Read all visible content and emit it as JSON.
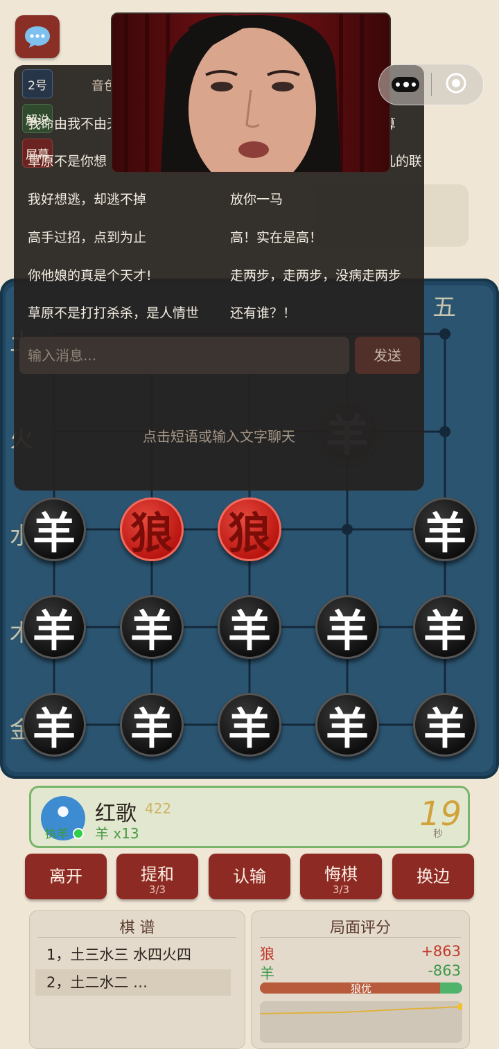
{
  "chat": {
    "side_buttons": [
      "2号",
      "解说",
      "屏幕"
    ],
    "header_partial": "音色",
    "phrases_left": [
      "我命由我不由天",
      "草原不是你想",
      "我好想逃，却逃不掉",
      "高手过招，点到为止",
      "你他娘的真是个天才!",
      "草原不是打打杀杀，是人情世"
    ],
    "phrases_right": [
      "算",
      "儿的联",
      "放你一马",
      "高！实在是高！",
      "走两步，走两步，没病走两步",
      "还有谁？！"
    ],
    "input_placeholder": "输入消息...",
    "send_label": "发送",
    "hint": "点击短语或输入文字聊天"
  },
  "board": {
    "col_label": "五",
    "row_labels": [
      "土",
      "火",
      "水",
      "木",
      "金"
    ],
    "pieces": [
      {
        "char": "羊",
        "color": "black",
        "col": 0,
        "row": 2
      },
      {
        "char": "狼",
        "color": "red",
        "col": 1,
        "row": 2
      },
      {
        "char": "狼",
        "color": "red",
        "col": 2,
        "row": 2
      },
      {
        "char": "羊",
        "color": "black",
        "col": 4,
        "row": 2
      },
      {
        "char": "羊",
        "color": "black",
        "col": 0,
        "row": 3
      },
      {
        "char": "羊",
        "color": "black",
        "col": 1,
        "row": 3
      },
      {
        "char": "羊",
        "color": "black",
        "col": 2,
        "row": 3
      },
      {
        "char": "羊",
        "color": "black",
        "col": 3,
        "row": 3
      },
      {
        "char": "羊",
        "color": "black",
        "col": 4,
        "row": 3
      },
      {
        "char": "羊",
        "color": "black",
        "col": 0,
        "row": 4
      },
      {
        "char": "羊",
        "color": "black",
        "col": 1,
        "row": 4
      },
      {
        "char": "羊",
        "color": "black",
        "col": 2,
        "row": 4
      },
      {
        "char": "羊",
        "color": "black",
        "col": 3,
        "row": 4
      },
      {
        "char": "羊",
        "color": "black",
        "col": 4,
        "row": 4
      }
    ],
    "ghost_pieces": [
      {
        "char": "羊",
        "color": "black",
        "col": 3,
        "row": 1
      }
    ]
  },
  "player": {
    "name": "红歌",
    "score": "422",
    "role_badge": "执羊",
    "pieces": "羊 x13",
    "timer": "19",
    "timer_unit": "秒"
  },
  "actions": [
    {
      "label": "离开",
      "sub": ""
    },
    {
      "label": "提和",
      "sub": "3/3"
    },
    {
      "label": "认输",
      "sub": ""
    },
    {
      "label": "悔棋",
      "sub": "3/3"
    },
    {
      "label": "换边",
      "sub": ""
    }
  ],
  "record": {
    "title": "棋  谱",
    "moves": [
      "1，土三水三 水四火四",
      "2，土二水二 …"
    ]
  },
  "evaluation": {
    "title": "局面评分",
    "wolf_label": "狼",
    "wolf_score": "+863",
    "sheep_label": "羊",
    "sheep_score": "-863",
    "verdict": "狼优",
    "wolf_share": 0.89,
    "colors": {
      "wolf": "#c0392b",
      "sheep": "#3d9a4b"
    }
  }
}
